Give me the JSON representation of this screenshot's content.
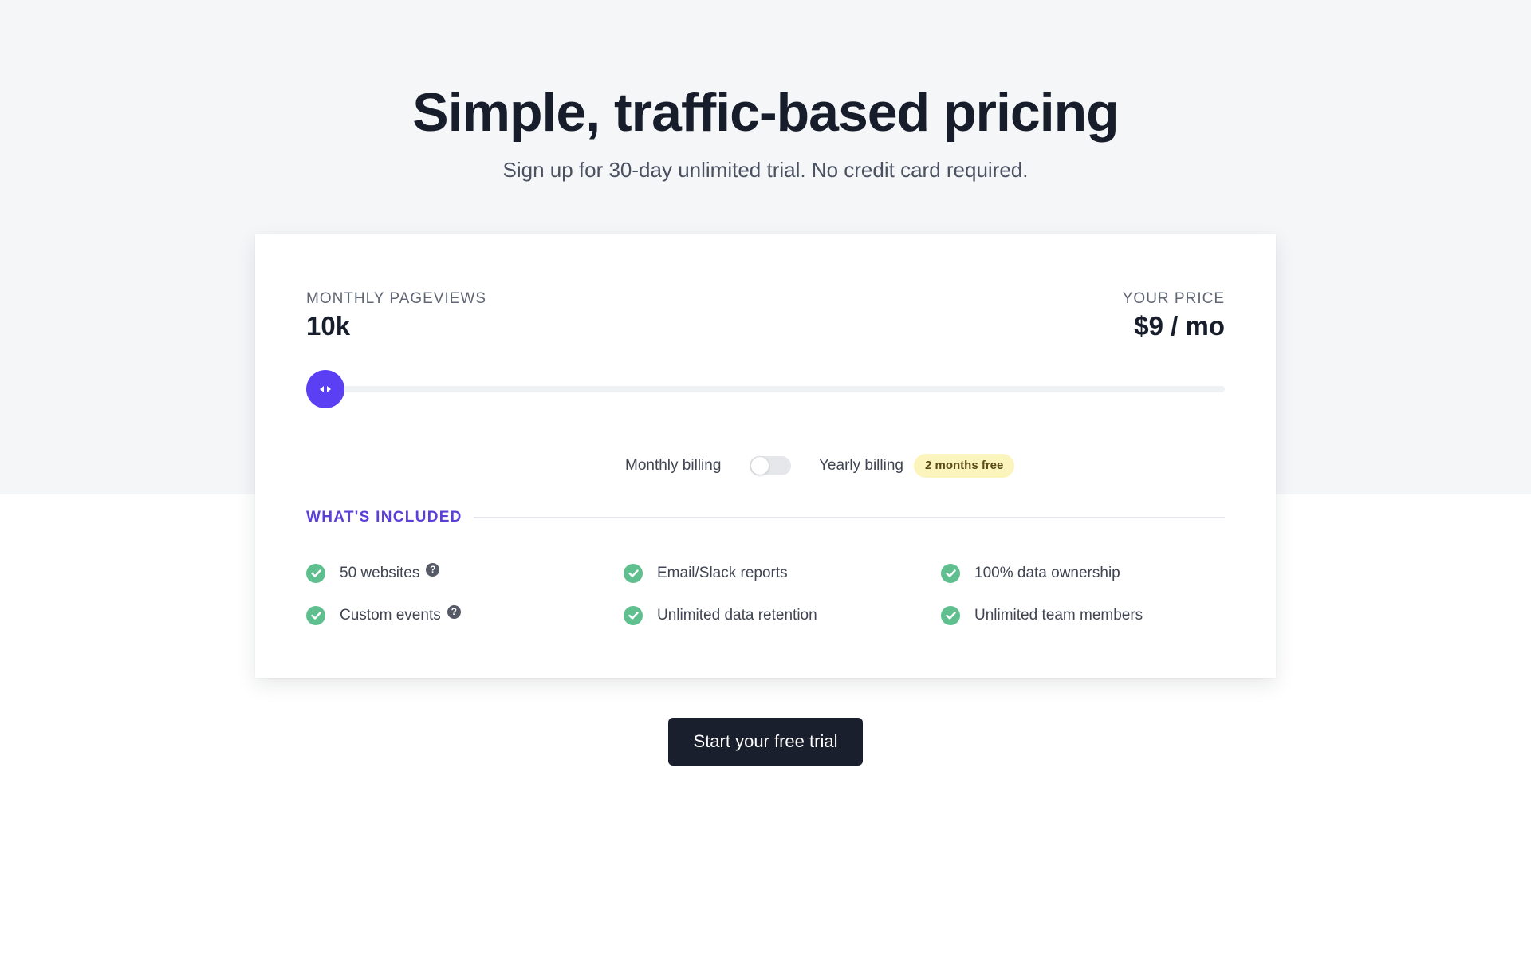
{
  "hero": {
    "title": "Simple, traffic-based pricing",
    "subtitle": "Sign up for 30-day unlimited trial. No credit card required."
  },
  "pricing": {
    "pageviews_label": "MONTHLY PAGEVIEWS",
    "pageviews_value": "10k",
    "price_label": "YOUR PRICE",
    "price_value": "$9 / mo",
    "slider_fraction": 0
  },
  "billing": {
    "monthly_label": "Monthly billing",
    "yearly_label": "Yearly billing",
    "yearly_enabled": false,
    "badge": "2 months free"
  },
  "included": {
    "heading": "WHAT'S INCLUDED",
    "features": [
      {
        "label": "50 websites",
        "help": true
      },
      {
        "label": "Email/Slack reports",
        "help": false
      },
      {
        "label": "100% data ownership",
        "help": false
      },
      {
        "label": "Custom events",
        "help": true
      },
      {
        "label": "Unlimited data retention",
        "help": false
      },
      {
        "label": "Unlimited team members",
        "help": false
      }
    ]
  },
  "cta": {
    "label": "Start your free trial"
  },
  "colors": {
    "accent": "#5b3ff2",
    "check": "#5fbf8f",
    "badge_bg": "#fcf4bd",
    "cta_bg": "#1a1f2e"
  }
}
